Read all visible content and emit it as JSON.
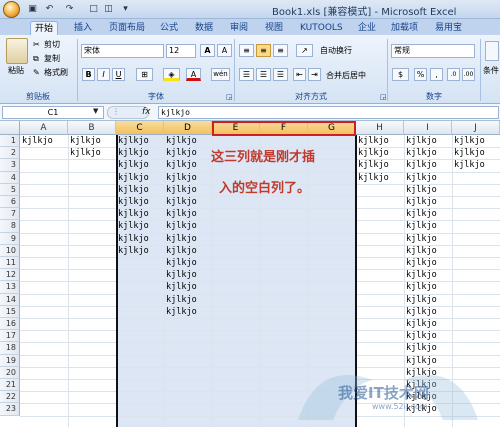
{
  "window": {
    "title": "Book1.xls  [兼容模式] - Microsoft Excel",
    "quick_access": {
      "save_icon": "save-icon",
      "undo_icon": "undo-icon",
      "redo_icon": "redo-icon",
      "new_icon": "new-file-icon",
      "print_preview_icon": "print-preview-icon"
    }
  },
  "tabs": [
    "开始",
    "插入",
    "页面布局",
    "公式",
    "数据",
    "审阅",
    "视图",
    "KUTOOLS",
    "企业",
    "加载项",
    "易用宝"
  ],
  "ribbon": {
    "clipboard": {
      "paste": "粘贴",
      "cut": "剪切",
      "copy": "复制",
      "format_painter": "格式刷",
      "group": "剪贴板"
    },
    "font": {
      "name": "宋体",
      "size": "12",
      "grow": "A",
      "shrink": "A",
      "bold": "B",
      "italic": "I",
      "underline": "U",
      "font_color_glyph": "A",
      "phonetic": "wén",
      "group": "字体"
    },
    "alignment": {
      "wrap": "自动换行",
      "merge": "合并后居中",
      "group": "对齐方式"
    },
    "number": {
      "format": "常规",
      "percent": "%",
      "comma": ",",
      "group": "数字"
    },
    "styles": {
      "cond_format": "条件"
    }
  },
  "formula_bar": {
    "name_box": "C1",
    "fx": "fx",
    "value": "kjlkjo"
  },
  "columns": [
    "A",
    "B",
    "C",
    "D",
    "E",
    "F",
    "G",
    "H",
    "I",
    "J"
  ],
  "selected_columns": [
    "C",
    "D",
    "E",
    "F",
    "G"
  ],
  "highlighted_columns": [
    "E",
    "F",
    "G"
  ],
  "rows": [
    "1",
    "2",
    "3",
    "4",
    "5",
    "6",
    "7",
    "8",
    "9",
    "10",
    "11",
    "12",
    "13",
    "14",
    "15",
    "16",
    "17",
    "18",
    "19",
    "20",
    "21",
    "22",
    "23"
  ],
  "cell_text": "kjlkjo",
  "cells": {
    "A": [
      "kjlkjo"
    ],
    "B": [
      "kjlkjo",
      "kjlkjo"
    ],
    "C": [
      "kjlkjo",
      "kjlkjo",
      "kjlkjo",
      "kjlkjo",
      "kjlkjo",
      "kjlkjo",
      "kjlkjo",
      "kjlkjo",
      "kjlkjo",
      "kjlkjo"
    ],
    "D": [
      "kjlkjo",
      "kjlkjo",
      "kjlkjo",
      "kjlkjo",
      "kjlkjo",
      "kjlkjo",
      "kjlkjo",
      "kjlkjo",
      "kjlkjo",
      "kjlkjo",
      "kjlkjo",
      "kjlkjo",
      "kjlkjo",
      "kjlkjo",
      "kjlkjo"
    ],
    "H": [
      "kjlkjo",
      "kjlkjo",
      "kjlkjo",
      "kjlkjo"
    ],
    "I": [
      "kjlkjo",
      "kjlkjo",
      "kjlkjo",
      "kjlkjo",
      "kjlkjo",
      "kjlkjo",
      "kjlkjo",
      "kjlkjo",
      "kjlkjo",
      "kjlkjo",
      "kjlkjo",
      "kjlkjo",
      "kjlkjo",
      "kjlkjo",
      "kjlkjo",
      "kjlkjo",
      "kjlkjo",
      "kjlkjo",
      "kjlkjo",
      "kjlkjo",
      "kjlkjo",
      "kjlkjo",
      "kjlkjo"
    ],
    "J": [
      "kjlkjo",
      "kjlkjo",
      "kjlkjo"
    ]
  },
  "annotation": {
    "line1": "这三列就是刚才插",
    "line2": "入的空白列了。"
  },
  "watermark": {
    "text": "我爱IT技术网",
    "url": "www.52ij.com"
  },
  "colors": {
    "annotation": "#c0392b",
    "highlight_border": "#d11f1f",
    "selection_fill": "#dde6f4"
  }
}
